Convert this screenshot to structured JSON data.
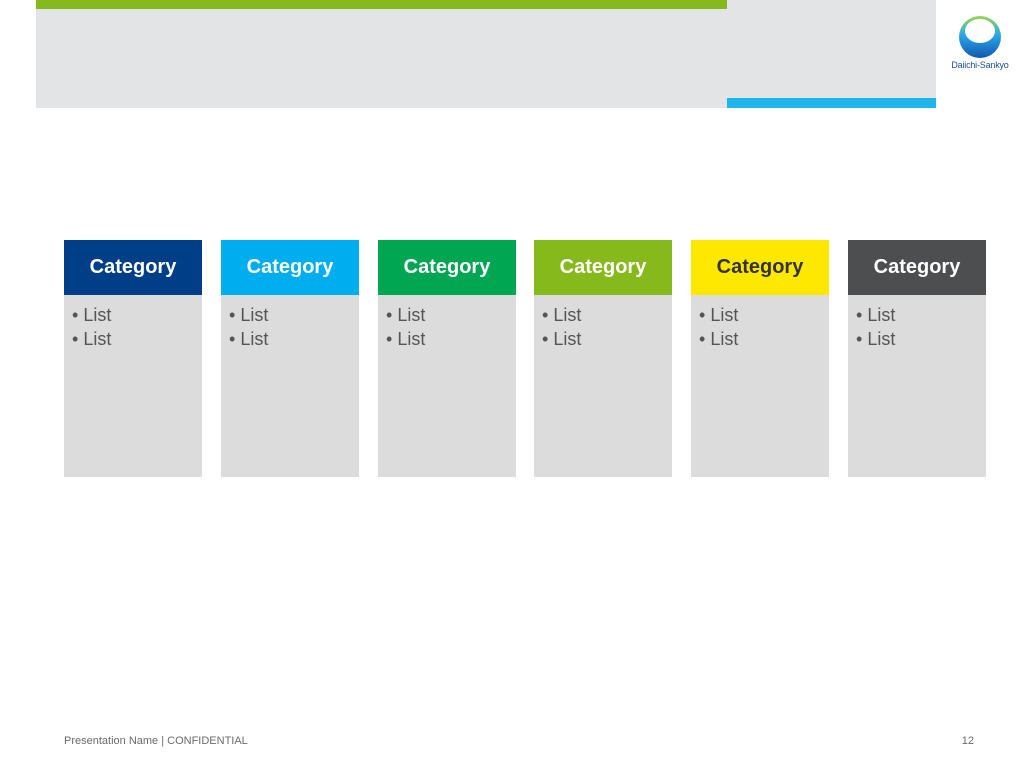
{
  "brand": {
    "logo_text": "Daiichi-Sankyo",
    "colors": {
      "title_band": "#e3e4e5",
      "green_rule": "#86b91c",
      "blue_rule": "#1fb5ea"
    }
  },
  "categories": [
    {
      "title": "Category",
      "color": "#003f87",
      "text_color": "#ffffff",
      "items": [
        "List",
        "List"
      ]
    },
    {
      "title": "Category",
      "color": "#00aeef",
      "text_color": "#ffffff",
      "items": [
        "List",
        "List"
      ]
    },
    {
      "title": "Category",
      "color": "#00a651",
      "text_color": "#ffffff",
      "items": [
        "List",
        "List"
      ]
    },
    {
      "title": "Category",
      "color": "#86b91c",
      "text_color": "#ffffff",
      "items": [
        "List",
        "List"
      ]
    },
    {
      "title": "Category",
      "color": "#ffe800",
      "text_color": "#333333",
      "items": [
        "List",
        "List"
      ]
    },
    {
      "title": "Category",
      "color": "#4d4e50",
      "text_color": "#ffffff",
      "items": [
        "List",
        "List"
      ]
    }
  ],
  "footer": {
    "left": "Presentation Name | CONFIDENTIAL",
    "page_number": "12"
  }
}
